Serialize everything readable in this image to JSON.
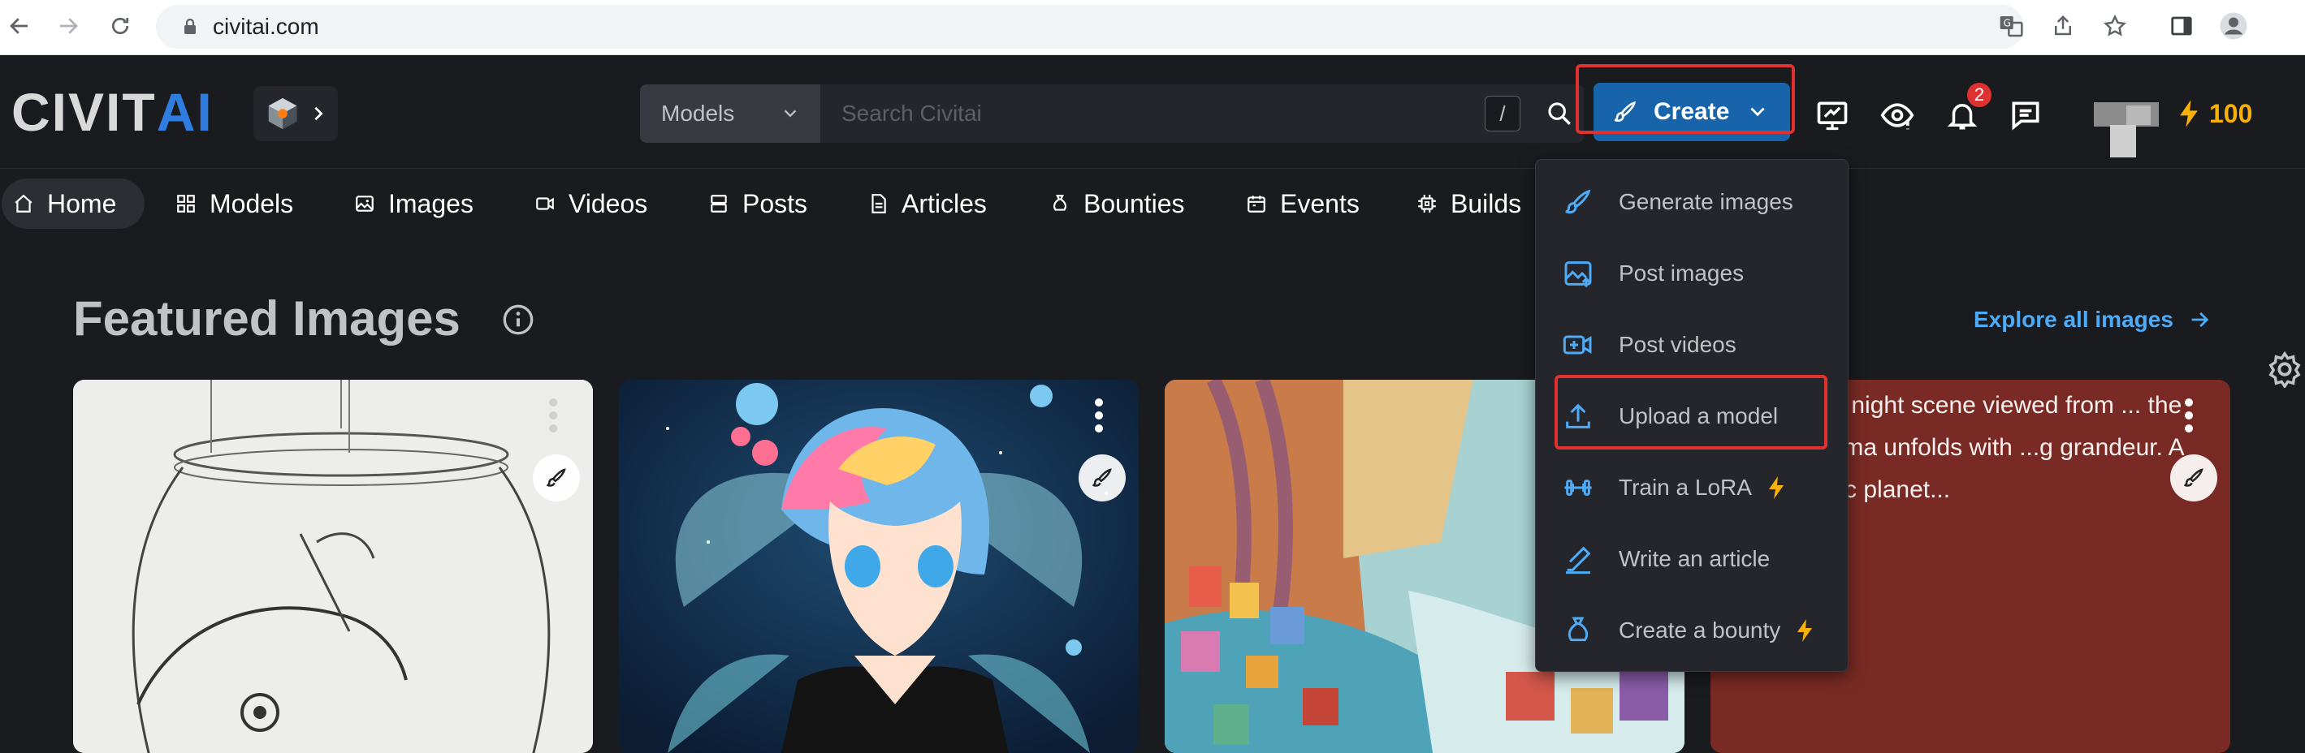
{
  "browser": {
    "url": "civitai.com"
  },
  "header": {
    "logo_text_a": "CIVIT",
    "logo_text_b": "AI",
    "search_type": "Models",
    "search_placeholder": "Search Civitai",
    "search_shortcut": "/",
    "create_label": "Create",
    "notification_count": "2",
    "buzz_count": "100"
  },
  "tabs": [
    {
      "label": "Home"
    },
    {
      "label": "Models"
    },
    {
      "label": "Images"
    },
    {
      "label": "Videos"
    },
    {
      "label": "Posts"
    },
    {
      "label": "Articles"
    },
    {
      "label": "Bounties"
    },
    {
      "label": "Events"
    },
    {
      "label": "Builds"
    }
  ],
  "main": {
    "featured_title": "Featured Images",
    "explore_label": "Explore all images",
    "card4_text": "...thical night scene viewed from ... the panorama unfolds with ...g grandeur. A majestic planet..."
  },
  "dropdown": {
    "items": [
      {
        "label": "Generate images",
        "icon": "brush-icon"
      },
      {
        "label": "Post images",
        "icon": "photo-up-icon"
      },
      {
        "label": "Post videos",
        "icon": "video-plus-icon"
      },
      {
        "label": "Upload a model",
        "icon": "upload-icon"
      },
      {
        "label": "Train a LoRA",
        "icon": "barbell-icon"
      },
      {
        "label": "Write an article",
        "icon": "pencil-line-icon"
      },
      {
        "label": "Create a bounty",
        "icon": "moneybag-icon"
      }
    ]
  },
  "colors": {
    "accent": "#1864ab",
    "highlight": "#e03131",
    "link": "#4dabf7",
    "buzz": "#fab005"
  }
}
